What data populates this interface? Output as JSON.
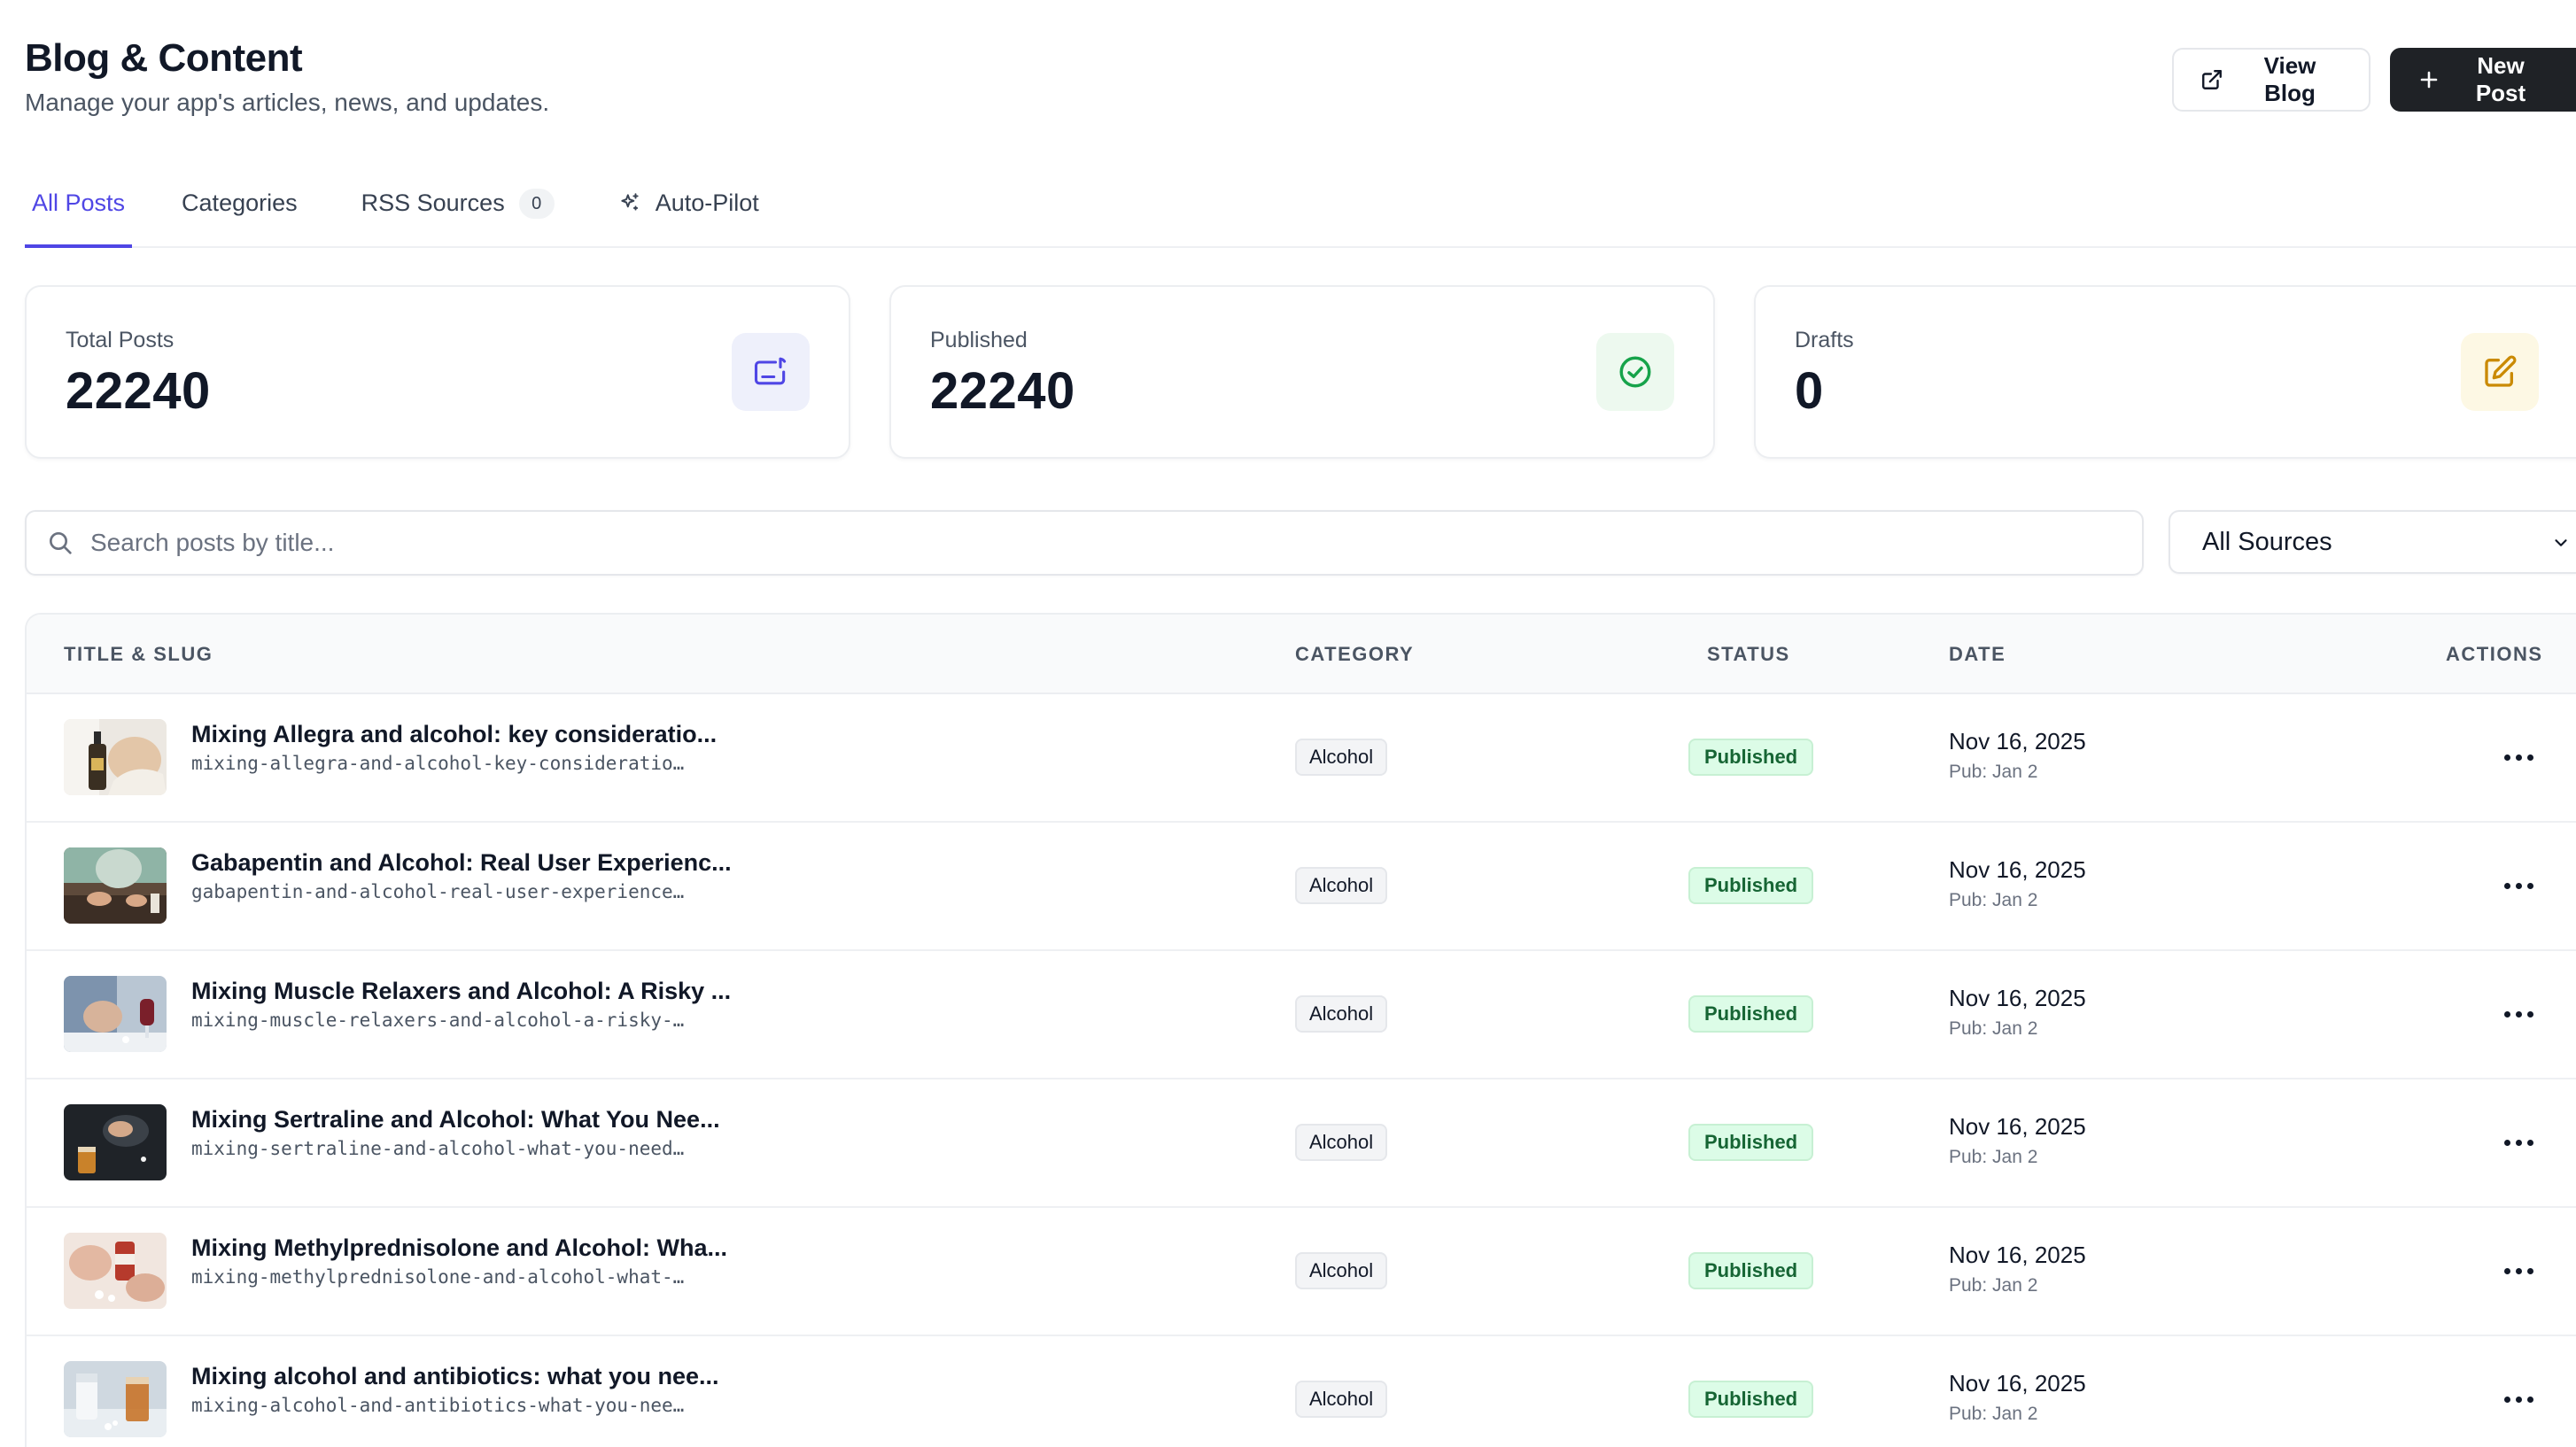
{
  "header": {
    "title": "Blog & Content",
    "subtitle": "Manage your app's articles, news, and updates.",
    "view_blog_label": "View Blog",
    "new_post_label": "New Post"
  },
  "tabs": [
    {
      "label": "All Posts",
      "active": true
    },
    {
      "label": "Categories"
    },
    {
      "label": "RSS Sources",
      "count": "0"
    },
    {
      "label": "Auto-Pilot",
      "icon": "sparkles-icon"
    }
  ],
  "stats": [
    {
      "label": "Total Posts",
      "value": "22240",
      "icon": "posts-icon",
      "icon_bg": "#eef0fb",
      "icon_color": "#4f46e5"
    },
    {
      "label": "Published",
      "value": "22240",
      "icon": "check-circle-icon",
      "icon_bg": "#edf9ef",
      "icon_color": "#16a34a"
    },
    {
      "label": "Drafts",
      "value": "0",
      "icon": "edit-icon",
      "icon_bg": "#fdf8e4",
      "icon_color": "#ca8a04"
    }
  ],
  "search": {
    "placeholder": "Search posts by title...",
    "value": ""
  },
  "source_filter": {
    "selected": "All Sources"
  },
  "table": {
    "columns": {
      "title": "TITLE & SLUG",
      "category": "CATEGORY",
      "status": "STATUS",
      "date": "DATE",
      "actions": "ACTIONS"
    },
    "rows": [
      {
        "title": "Mixing Allegra and alcohol: key consideratio...",
        "slug": "mixing-allegra-and-alcohol-key-consideratio…",
        "category": "Alcohol",
        "status": "Published",
        "date": "Nov 16, 2025",
        "pub": "Pub: Jan 2"
      },
      {
        "title": "Gabapentin and Alcohol: Real User Experienc...",
        "slug": "gabapentin-and-alcohol-real-user-experience…",
        "category": "Alcohol",
        "status": "Published",
        "date": "Nov 16, 2025",
        "pub": "Pub: Jan 2"
      },
      {
        "title": "Mixing Muscle Relaxers and Alcohol: A Risky ...",
        "slug": "mixing-muscle-relaxers-and-alcohol-a-risky-…",
        "category": "Alcohol",
        "status": "Published",
        "date": "Nov 16, 2025",
        "pub": "Pub: Jan 2"
      },
      {
        "title": "Mixing Sertraline and Alcohol: What You Nee...",
        "slug": "mixing-sertraline-and-alcohol-what-you-need…",
        "category": "Alcohol",
        "status": "Published",
        "date": "Nov 16, 2025",
        "pub": "Pub: Jan 2"
      },
      {
        "title": "Mixing Methylprednisolone and Alcohol: Wha...",
        "slug": "mixing-methylprednisolone-and-alcohol-what-…",
        "category": "Alcohol",
        "status": "Published",
        "date": "Nov 16, 2025",
        "pub": "Pub: Jan 2"
      },
      {
        "title": "Mixing alcohol and antibiotics: what you nee...",
        "slug": "mixing-alcohol-and-antibiotics-what-you-nee…",
        "category": "Alcohol",
        "status": "Published",
        "date": "Nov 16, 2025",
        "pub": "Pub: Jan 2"
      }
    ]
  }
}
